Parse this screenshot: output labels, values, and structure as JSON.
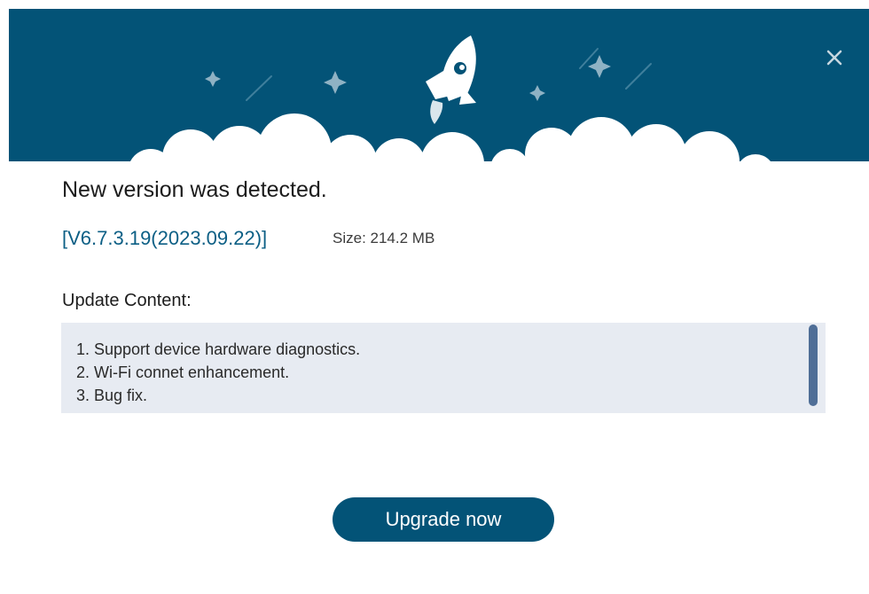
{
  "colors": {
    "header_bg": "#035377",
    "link": "#0c5f85",
    "content_bg": "#e7ebf2",
    "scrollbar": "#4f6e97",
    "button_bg": "#035377",
    "button_text": "#ffffff"
  },
  "header": {
    "illustration": "rocket-launch-with-clouds-and-stars",
    "close_icon": "close-icon"
  },
  "title": "New version was detected.",
  "version": {
    "label": "[V6.7.3.19(2023.09.22)]",
    "size_text": "Size: 214.2 MB"
  },
  "update_content": {
    "label": "Update Content:",
    "items": [
      "1. Support device hardware diagnostics.",
      "2. Wi-Fi connet enhancement.",
      "3. Bug fix."
    ]
  },
  "actions": {
    "upgrade_label": "Upgrade now"
  }
}
